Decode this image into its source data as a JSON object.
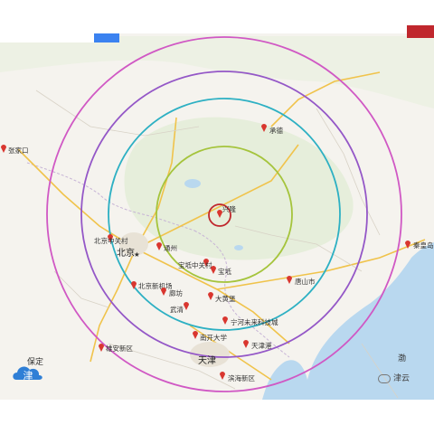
{
  "map": {
    "center_label": "兴隆",
    "rings": [
      {
        "color": "#a5c43c"
      },
      {
        "color": "#2db0c3"
      },
      {
        "color": "#9457c7"
      },
      {
        "color": "#d058c4"
      }
    ],
    "epicenter_color": "#c0272d",
    "places": [
      {
        "label": "张家口"
      },
      {
        "label": "承德"
      },
      {
        "label": "秦皇岛"
      },
      {
        "label": "唐山市"
      },
      {
        "label": "北京中关村"
      },
      {
        "label": "北京"
      },
      {
        "label": "通州"
      },
      {
        "label": "北京新机场"
      },
      {
        "label": "廊坊"
      },
      {
        "label": "宝坻中关村"
      },
      {
        "label": "宝坻"
      },
      {
        "label": "大黄堡"
      },
      {
        "label": "武清"
      },
      {
        "label": "宁河未来科技城"
      },
      {
        "label": "雄安新区"
      },
      {
        "label": "南开大学"
      },
      {
        "label": "天津"
      },
      {
        "label": "天津港"
      },
      {
        "label": "滨海新区"
      },
      {
        "label": "保定"
      },
      {
        "label": "渤"
      }
    ],
    "credit": "津云",
    "watermark_char": "津"
  }
}
